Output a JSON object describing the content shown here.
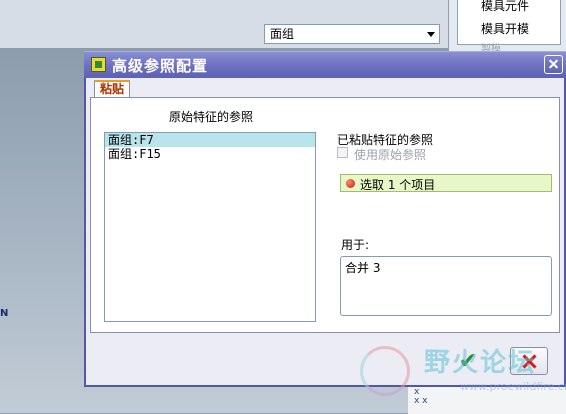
{
  "background": {
    "feature_combo_value": "面组",
    "panel_items": [
      "模具元件",
      "模具开模",
      "製模"
    ],
    "viewport_label": "N",
    "bottom_glyph": "x\nx x"
  },
  "dialog": {
    "title": "高级参照配置",
    "tab": "粘贴",
    "original_refs_label": "原始特征的参照",
    "original_refs": [
      "面组:F7",
      "面组:F15"
    ],
    "pasted_refs_label": "已粘贴特征的参照",
    "use_original_label": "使用原始参照",
    "collector_text": "选取 1 个项目",
    "used_for_label": "用于:",
    "used_for_items": [
      "合并 3"
    ]
  },
  "watermark": {
    "title": "野火论坛",
    "url": "www.proewildfire.cn"
  },
  "colors": {
    "titlebar": "#6e72c0",
    "tab_text": "#b03200",
    "selected_row": "#b9e4ec",
    "collector_bg": "#e8f7c8",
    "ok_check": "#2f8f2f",
    "cancel_x": "#d0221a"
  }
}
